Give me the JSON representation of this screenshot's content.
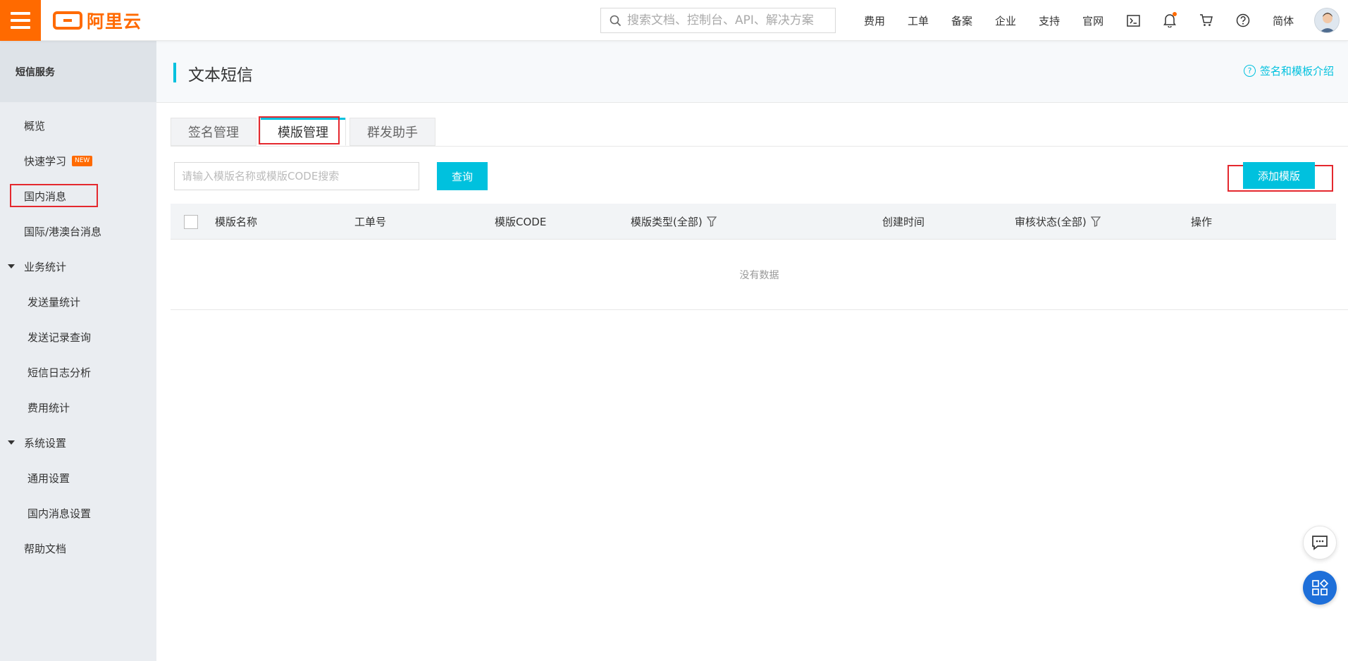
{
  "colors": {
    "brand_orange": "#ff6a00",
    "accent_cyan": "#00c1de",
    "highlight_red": "#e4282e",
    "fab_blue": "#1e6fd9"
  },
  "header": {
    "logo_text": "阿里云",
    "search_placeholder": "搜索文档、控制台、API、解决方案",
    "nav_links": [
      "费用",
      "工单",
      "备案",
      "企业",
      "支持",
      "官网"
    ],
    "icons": [
      "terminal-icon",
      "bell-icon",
      "cart-icon",
      "help-icon"
    ],
    "language": "简体"
  },
  "sidebar": {
    "title": "短信服务",
    "items": [
      {
        "label": "概览"
      },
      {
        "label": "快速学习",
        "badge": "NEW"
      },
      {
        "label": "国内消息"
      },
      {
        "label": "国际/港澳台消息"
      },
      {
        "label": "业务统计"
      },
      {
        "label": "发送量统计"
      },
      {
        "label": "发送记录查询"
      },
      {
        "label": "短信日志分析"
      },
      {
        "label": "费用统计"
      },
      {
        "label": "系统设置"
      },
      {
        "label": "通用设置"
      },
      {
        "label": "国内消息设置"
      },
      {
        "label": "帮助文档"
      }
    ]
  },
  "main": {
    "page_title": "文本短信",
    "help_link": "签名和模板介绍",
    "tabs": [
      {
        "label": "签名管理"
      },
      {
        "label": "模版管理"
      },
      {
        "label": "群发助手"
      }
    ],
    "filter_placeholder": "请输入模版名称或模版CODE搜索",
    "query_button": "查询",
    "add_button": "添加模版",
    "table": {
      "columns": [
        "模版名称",
        "工单号",
        "模版CODE",
        "模版类型(全部)",
        "创建时间",
        "审核状态(全部)",
        "操作"
      ],
      "empty_text": "没有数据"
    }
  }
}
